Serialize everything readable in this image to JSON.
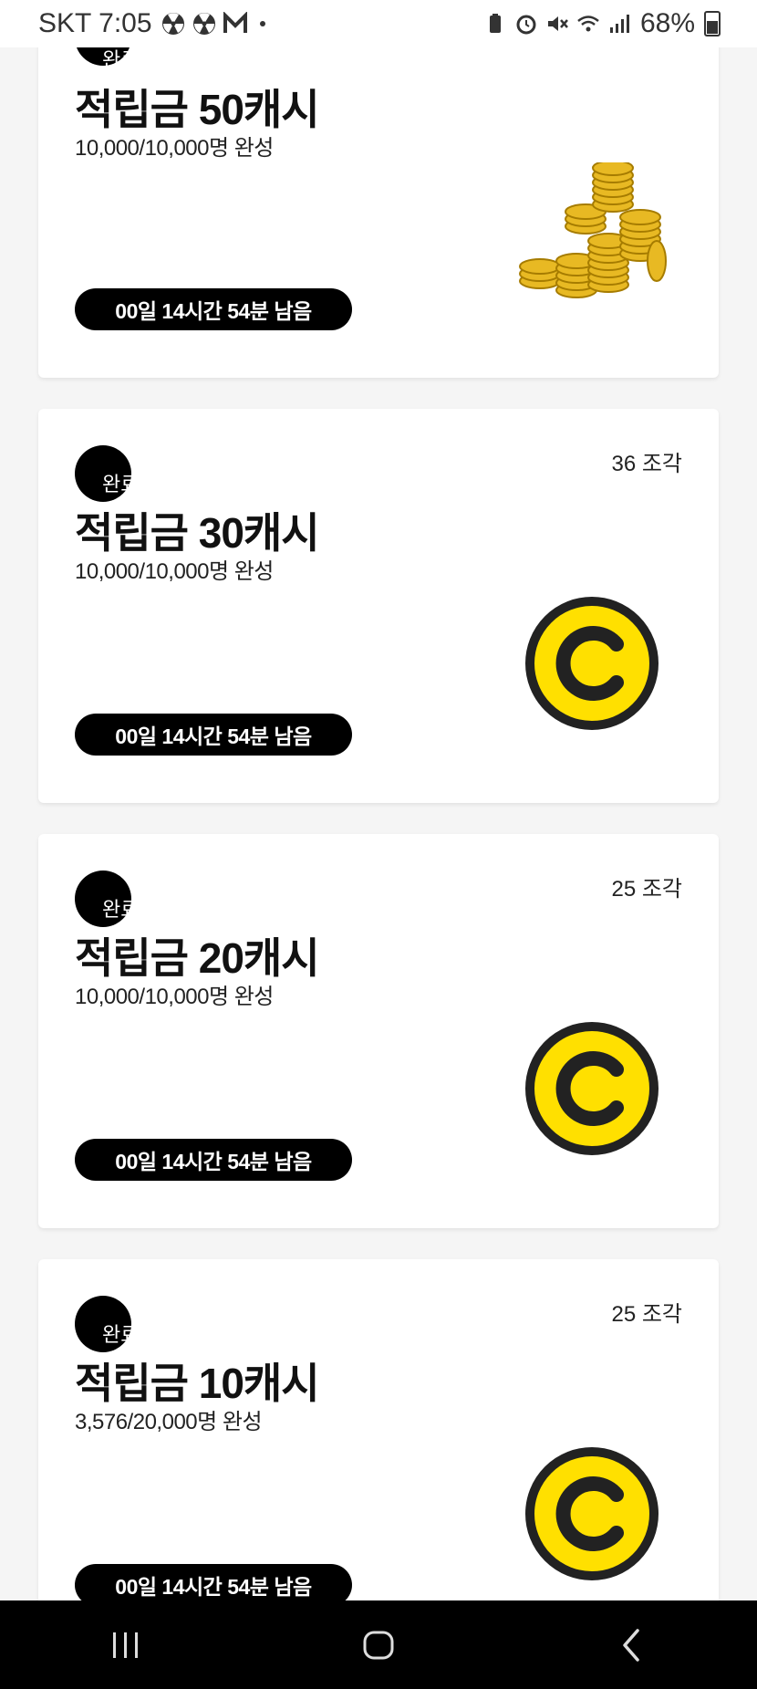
{
  "status_bar": {
    "carrier_time": "SKT 7:05",
    "battery": "68%"
  },
  "colors": {
    "coin_yellow": "#FFE000",
    "coin_ring": "#222222",
    "badge": "#000000",
    "timer_bg": "#000000"
  },
  "cards": [
    {
      "badge": "완료",
      "pieces": "",
      "title": "적립금 50캐시",
      "progress": "10,000/10,000명 완성",
      "timer": "00일 14시간 54분 남음",
      "icon": "gold-coins-stack-icon"
    },
    {
      "badge": "완료",
      "pieces": "36 조각",
      "title": "적립금 30캐시",
      "progress": "10,000/10,000명 완성",
      "timer": "00일 14시간 54분 남음",
      "icon": "cash-coin-icon"
    },
    {
      "badge": "완료",
      "pieces": "25 조각",
      "title": "적립금 20캐시",
      "progress": "10,000/10,000명 완성",
      "timer": "00일 14시간 54분 남음",
      "icon": "cash-coin-icon"
    },
    {
      "badge": "완료",
      "pieces": "25 조각",
      "title": "적립금 10캐시",
      "progress": "3,576/20,000명 완성",
      "timer": "00일 14시간 54분 남음",
      "icon": "cash-coin-icon"
    }
  ],
  "nav": {
    "recents": "recent-apps-icon",
    "home": "home-icon",
    "back": "back-icon"
  }
}
